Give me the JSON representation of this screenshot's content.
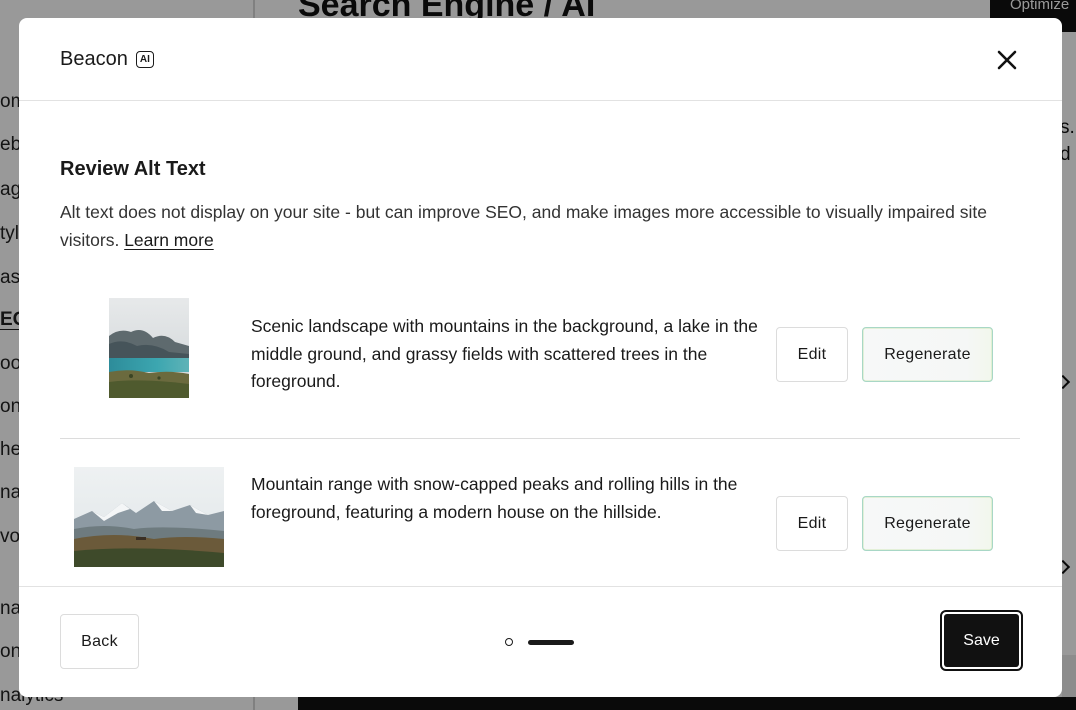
{
  "background": {
    "page_title": "Search Engine / AI",
    "optimize_button": "Optimize",
    "sidebar_items": [
      "om",
      "eb",
      "ag",
      "tyl",
      "ass",
      "EO",
      "oo",
      "ont",
      "he",
      "na",
      "vo",
      "na",
      "ont",
      "nalytics"
    ],
    "right_text": [
      "s.",
      "d"
    ]
  },
  "modal": {
    "brand": "Beacon",
    "ai_badge": "AI",
    "section_title": "Review Alt Text",
    "description": "Alt text does not display on your site - but can improve SEO, and make images more accessible to visually impaired site visitors.",
    "learn_more": "Learn more",
    "items": [
      {
        "alt_text": "Scenic landscape with mountains in the background, a lake in the middle ground, and grassy fields with scattered trees in the foreground.",
        "edit_label": "Edit",
        "regenerate_label": "Regenerate"
      },
      {
        "alt_text": "Mountain range with snow-capped peaks and rolling hills in the foreground, featuring a modern house on the hillside.",
        "edit_label": "Edit",
        "regenerate_label": "Regenerate"
      }
    ],
    "footer": {
      "back_label": "Back",
      "save_label": "Save",
      "pagination": {
        "pages": 2,
        "current": 2
      }
    }
  },
  "colors": {
    "primary": "#111111",
    "overlay": "rgba(0,0,0,0.4)",
    "regenerate_border": "#a8d7c6",
    "divider": "#dcdcdc"
  },
  "icons": {
    "close": "close-icon"
  }
}
